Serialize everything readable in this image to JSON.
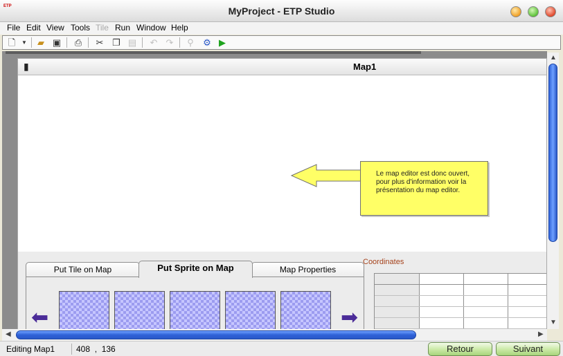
{
  "window": {
    "title": "MyProject - ETP Studio",
    "app_icon_text": "ETP"
  },
  "menu": [
    "File",
    "Edit",
    "View",
    "Tools",
    "Tile",
    "Run",
    "Window",
    "Help"
  ],
  "toolbar": {
    "icons": [
      "new-file-icon",
      "dropdown-arrow-icon",
      "open-folder-icon",
      "save-icon",
      "print-icon",
      "cut-icon",
      "copy-icon",
      "paste-icon",
      "undo-icon",
      "redo-icon",
      "binoculars-icon",
      "gear-icon",
      "play-icon"
    ]
  },
  "child_window": {
    "title": "Map1"
  },
  "callout": {
    "text": "Le map editor est donc ouvert, pour plus d'information voir la présentation du map editor."
  },
  "tabs": {
    "items": [
      "Put Tile on Map",
      "Put Sprite on Map",
      "Map Properties"
    ],
    "active": "Put Sprite on Map"
  },
  "coordinates": {
    "label": "Coordinates"
  },
  "statusbar": {
    "mode": "Editing Map1",
    "coords": "408  ,  136"
  },
  "nav": {
    "back": "Retour",
    "next": "Suivant"
  },
  "colors": {
    "accent_blue": "#2f62d8",
    "callout_yellow": "#ffff66",
    "sprite_purple": "#9c9cf0",
    "nav_green": "#a8d57b"
  }
}
